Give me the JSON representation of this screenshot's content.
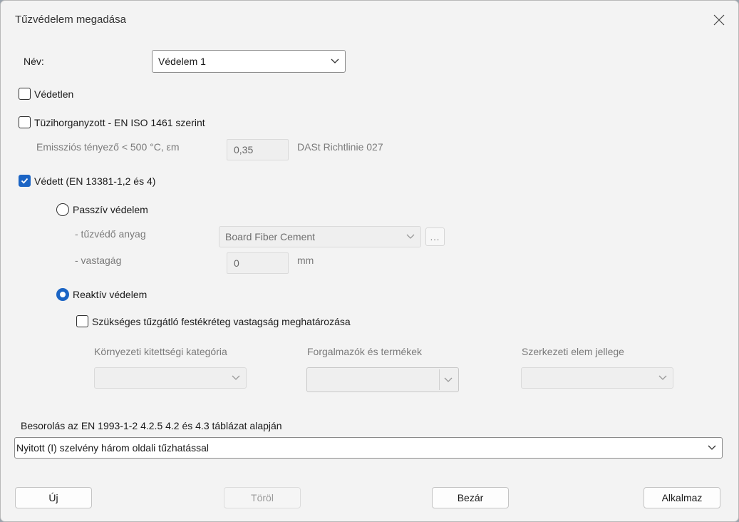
{
  "window": {
    "title": "Tűzvédelem megadása"
  },
  "name_field": {
    "label": "Név:",
    "value": "Védelem 1"
  },
  "unprotected": {
    "label": "Védetlen",
    "checked": false
  },
  "galvanized": {
    "label": "Tüzihorganyzott - EN ISO 1461 szerint",
    "checked": false,
    "emission_label": "Emissziós tényező < 500 °C,  εm",
    "emission_value": "0,35",
    "reference": "DASt Richtlinie 027"
  },
  "protected": {
    "label": "Védett (EN 13381-1,2 és 4)",
    "checked": true,
    "passive": {
      "label": "Passzív védelem",
      "selected": false,
      "material_label": "- tűzvédő anyag",
      "material_value": "Board Fiber Cement",
      "browse_label": "...",
      "thickness_label": "- vastagág",
      "thickness_value": "0",
      "thickness_unit": "mm"
    },
    "reactive": {
      "label": "Reaktív védelem",
      "selected": true,
      "determine_label": "Szükséges tűzgátló festékréteg vastagság meghatározása",
      "determine_checked": false,
      "exposure_label": "Környezeti kitettségi kategória",
      "exposure_value": "",
      "vendors_label": "Forgalmazók és termékek",
      "vendors_value": "",
      "element_label": "Szerkezeti elem jellege",
      "element_value": ""
    }
  },
  "classification": {
    "label": "Besorolás az EN 1993-1-2 4.2.5 4.2 és 4.3 táblázat alapján",
    "value": "Nyitott (I) szelvény három oldali tűzhatással"
  },
  "buttons": {
    "new": "Új",
    "delete": "Töröl",
    "close": "Bezár",
    "apply": "Alkalmaz"
  },
  "colors": {
    "accent": "#1b64c4",
    "background": "#f3f3f3"
  }
}
